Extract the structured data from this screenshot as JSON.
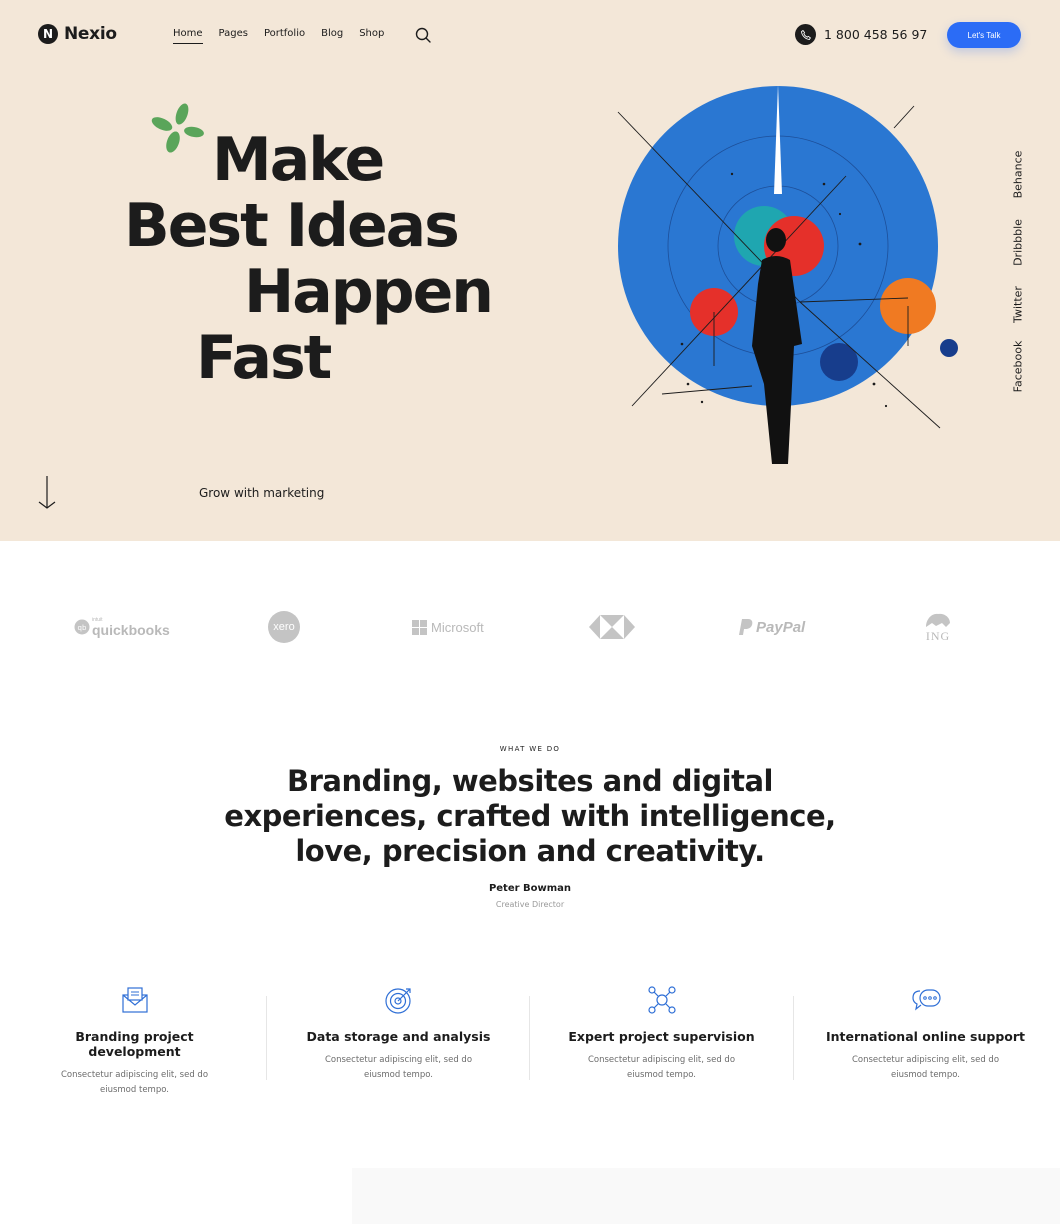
{
  "header": {
    "logo_mark": "N",
    "logo_text": "Nexio",
    "nav": [
      "Home",
      "Pages",
      "Portfolio",
      "Blog",
      "Shop"
    ],
    "phone": "1 800 458 56 97",
    "cta_label": "Let's Talk"
  },
  "hero": {
    "line1": "Make",
    "line2": "Best Ideas",
    "line3": "Happen",
    "line4": "Fast",
    "tagline": "Grow with marketing",
    "social": [
      "Behance",
      "Dribbble",
      "Twitter",
      "Facebook"
    ]
  },
  "clients": {
    "quickbooks_small": "intuit",
    "quickbooks": "quickbooks",
    "xero": "xero",
    "microsoft": "Microsoft",
    "paypal": "PayPal",
    "ing": "ING"
  },
  "about": {
    "eyebrow": "WHAT WE DO",
    "statement": "Branding, websites and digital experiences, crafted with intelligence, love, precision and creativity.",
    "author": "Peter Bowman",
    "role": "Creative Director"
  },
  "services": [
    {
      "title": "Branding project development",
      "desc": "Consectetur adipiscing elit, sed do eiusmod tempo.",
      "icon": "envelope-icon"
    },
    {
      "title": "Data storage and analysis",
      "desc": "Consectetur adipiscing elit, sed do eiusmod tempo.",
      "icon": "target-icon"
    },
    {
      "title": "Expert project supervision",
      "desc": "Consectetur adipiscing elit, sed do eiusmod tempo.",
      "icon": "network-icon"
    },
    {
      "title": "International online support",
      "desc": "Consectetur adipiscing elit, sed do eiusmod tempo.",
      "icon": "chat-bubbles-icon"
    }
  ],
  "colors": {
    "hero_bg": "#f3e7d8",
    "accent_blue": "#2b6cf6",
    "icon_blue": "#2f6fd6",
    "leaf_green": "#5aa55a",
    "text": "#1c1c1c"
  }
}
